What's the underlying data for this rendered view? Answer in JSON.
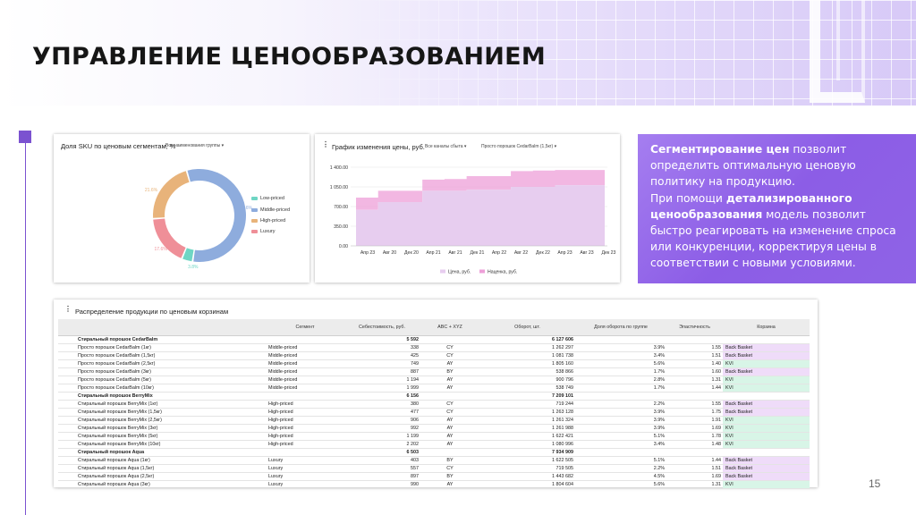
{
  "header": {
    "title": "УПРАВЛЕНИЕ ЦЕНООБРАЗОВАНИЕМ"
  },
  "donut": {
    "title": "Доля SKU по ценовым сегментам, %",
    "filter": "Все наименования группы",
    "legend": [
      "Low-priced",
      "Middle-priced",
      "High-priced",
      "Luxury"
    ],
    "labels": [
      "56.6%",
      "3.8%",
      "17.6%",
      "21.6%"
    ]
  },
  "line": {
    "title": "График изменения цены, руб.",
    "filter1": "Все каналы сбыта",
    "filter2": "Просто порошок CedarBalm (1,5кг)",
    "y_ticks": [
      "1 400.00",
      "1 050.00",
      "700.00",
      "350.00",
      "0.00"
    ],
    "x_ticks": [
      "Апр 23",
      "Авг 20",
      "Дек 20",
      "Апр 21",
      "Авг 21",
      "Дек 21",
      "Апр 22",
      "Авг 22",
      "Дек 22",
      "Апр 23",
      "Авг 23",
      "Дек 23"
    ],
    "legend": [
      "Цена, руб.",
      "Наценка, руб."
    ]
  },
  "chart_data": [
    {
      "type": "pie",
      "title": "Доля SKU по ценовым сегментам, %",
      "categories": [
        "Middle-priced",
        "Low-priced",
        "Luxury",
        "High-priced"
      ],
      "values": [
        56.6,
        3.8,
        17.6,
        21.6
      ],
      "colors": [
        "#8eacdd",
        "#6fd6c4",
        "#ef8f98",
        "#e8b37a"
      ],
      "legend": "right"
    },
    {
      "type": "area",
      "title": "График изменения цены, руб.",
      "xlabel": "",
      "ylabel": "",
      "ylim": [
        0,
        1400
      ],
      "x": [
        0,
        1,
        2,
        3,
        4,
        5,
        6,
        7,
        8,
        9,
        10,
        11
      ],
      "x_ticks": [
        "Апр 23",
        "Авг 20",
        "Дек 20",
        "Апр 21",
        "Авг 21",
        "Дек 21",
        "Апр 22",
        "Авг 22",
        "Дек 22",
        "Апр 23",
        "Авг 23",
        "Дек 23"
      ],
      "series": [
        {
          "name": "Цена, руб.",
          "color": "#e7cdef",
          "values": [
            640,
            780,
            780,
            980,
            980,
            1000,
            1000,
            1050,
            1050,
            1080,
            1080,
            1080
          ]
        },
        {
          "name": "Наценка, руб.",
          "color": "#ed9fd8",
          "values": [
            860,
            980,
            980,
            1180,
            1190,
            1240,
            1240,
            1330,
            1340,
            1350,
            1350,
            1350
          ]
        }
      ]
    }
  ],
  "textbox": {
    "p1_bold": "Сегментирование цен",
    "p1_rest": " позволит определить оптимальную ценовую политику на продукцию.",
    "p2_a": "При помощи ",
    "p2_bold": "детализированного ценообразования",
    "p2_rest": " модель позволит быстро реагировать на изменение спроса или конкуренции, корректируя цены в соответствии с новыми условиями."
  },
  "table": {
    "title": "Распределение продукции по ценовым корзинам",
    "columns": [
      "",
      "Сегмент",
      "Себестоимость, руб.",
      "ABC + XYZ",
      "Оборот, шт.",
      "Доля оборота по группе",
      "Эластичность",
      "Корзина"
    ],
    "rows": [
      {
        "name": "Стиральный порошок CedarBalm",
        "seg": "",
        "cost": "5 592",
        "abc": "",
        "turn": "6 127 606",
        "share": "",
        "el": "",
        "basket": "",
        "group": true
      },
      {
        "name": "Просто порошок CedarBalm (1кг)",
        "seg": "Middle-priced",
        "cost": "338",
        "abc": "CY",
        "turn": "1 262 297",
        "share": "3.9%",
        "el": "1.55",
        "basket": "Back Basket"
      },
      {
        "name": "Просто порошок CedarBalm (1,5кг)",
        "seg": "Middle-priced",
        "cost": "425",
        "abc": "CY",
        "turn": "1 081 738",
        "share": "3.4%",
        "el": "1.51",
        "basket": "Back Basket"
      },
      {
        "name": "Просто порошок CedarBalm (2,5кг)",
        "seg": "Middle-priced",
        "cost": "749",
        "abc": "AY",
        "turn": "1 805 160",
        "share": "5.6%",
        "el": "1.40",
        "basket": "KVI"
      },
      {
        "name": "Просто порошок CedarBalm (3кг)",
        "seg": "Middle-priced",
        "cost": "887",
        "abc": "BY",
        "turn": "538 866",
        "share": "1.7%",
        "el": "1.60",
        "basket": "Back Basket"
      },
      {
        "name": "Просто порошок CedarBalm (5кг)",
        "seg": "Middle-priced",
        "cost": "1 194",
        "abc": "AY",
        "turn": "900 796",
        "share": "2.8%",
        "el": "1.31",
        "basket": "KVI"
      },
      {
        "name": "Просто порошок CedarBalm (10кг)",
        "seg": "Middle-priced",
        "cost": "1 999",
        "abc": "AY",
        "turn": "538 749",
        "share": "1.7%",
        "el": "1.44",
        "basket": "KVI"
      },
      {
        "name": "Стиральный порошок BerryMix",
        "seg": "",
        "cost": "6 156",
        "abc": "",
        "turn": "7 209 101",
        "share": "",
        "el": "",
        "basket": "",
        "group": true
      },
      {
        "name": "Стиральный порошок BerryMix (1кг)",
        "seg": "High-priced",
        "cost": "380",
        "abc": "CY",
        "turn": "719 244",
        "share": "2.2%",
        "el": "1.55",
        "basket": "Back Basket"
      },
      {
        "name": "Стиральный порошок BerryMix (1,5кг)",
        "seg": "High-priced",
        "cost": "477",
        "abc": "CY",
        "turn": "1 263 128",
        "share": "3.9%",
        "el": "1.75",
        "basket": "Back Basket"
      },
      {
        "name": "Стиральный порошок BerryMix (2,5кг)",
        "seg": "High-priced",
        "cost": "906",
        "abc": "AY",
        "turn": "1 261 324",
        "share": "3.9%",
        "el": "1.91",
        "basket": "KVI"
      },
      {
        "name": "Стиральный порошок BerryMix (3кг)",
        "seg": "High-priced",
        "cost": "992",
        "abc": "AY",
        "turn": "1 261 988",
        "share": "3.9%",
        "el": "1.69",
        "basket": "KVI"
      },
      {
        "name": "Стиральный порошок BerryMix (5кг)",
        "seg": "High-priced",
        "cost": "1 199",
        "abc": "AY",
        "turn": "1 622 421",
        "share": "5.1%",
        "el": "1.78",
        "basket": "KVI"
      },
      {
        "name": "Стиральный порошок BerryMix (10кг)",
        "seg": "High-priced",
        "cost": "2 202",
        "abc": "AY",
        "turn": "1 080 996",
        "share": "3.4%",
        "el": "1.48",
        "basket": "KVI"
      },
      {
        "name": "Стиральный порошок Aqua",
        "seg": "",
        "cost": "6 503",
        "abc": "",
        "turn": "7 934 909",
        "share": "",
        "el": "",
        "basket": "",
        "group": true
      },
      {
        "name": "Стиральный порошок Aqua (1кг)",
        "seg": "Luxury",
        "cost": "403",
        "abc": "BY",
        "turn": "1 622 505",
        "share": "5.1%",
        "el": "1.44",
        "basket": "Back Basket"
      },
      {
        "name": "Стиральный порошок Aqua (1,5кг)",
        "seg": "Luxury",
        "cost": "557",
        "abc": "CY",
        "turn": "719 505",
        "share": "2.2%",
        "el": "1.51",
        "basket": "Back Basket"
      },
      {
        "name": "Стиральный порошок Aqua (2,5кг)",
        "seg": "Luxury",
        "cost": "897",
        "abc": "BY",
        "turn": "1 443 682",
        "share": "4.5%",
        "el": "1.69",
        "basket": "Back Basket"
      },
      {
        "name": "Стиральный порошок Aqua (3кг)",
        "seg": "Luxury",
        "cost": "990",
        "abc": "AY",
        "turn": "1 804 604",
        "share": "5.6%",
        "el": "1.31",
        "basket": "KVI"
      }
    ]
  },
  "page": {
    "number": "15"
  },
  "colors": {
    "accent": "#7b52d0",
    "textbox": "#9468e8"
  }
}
